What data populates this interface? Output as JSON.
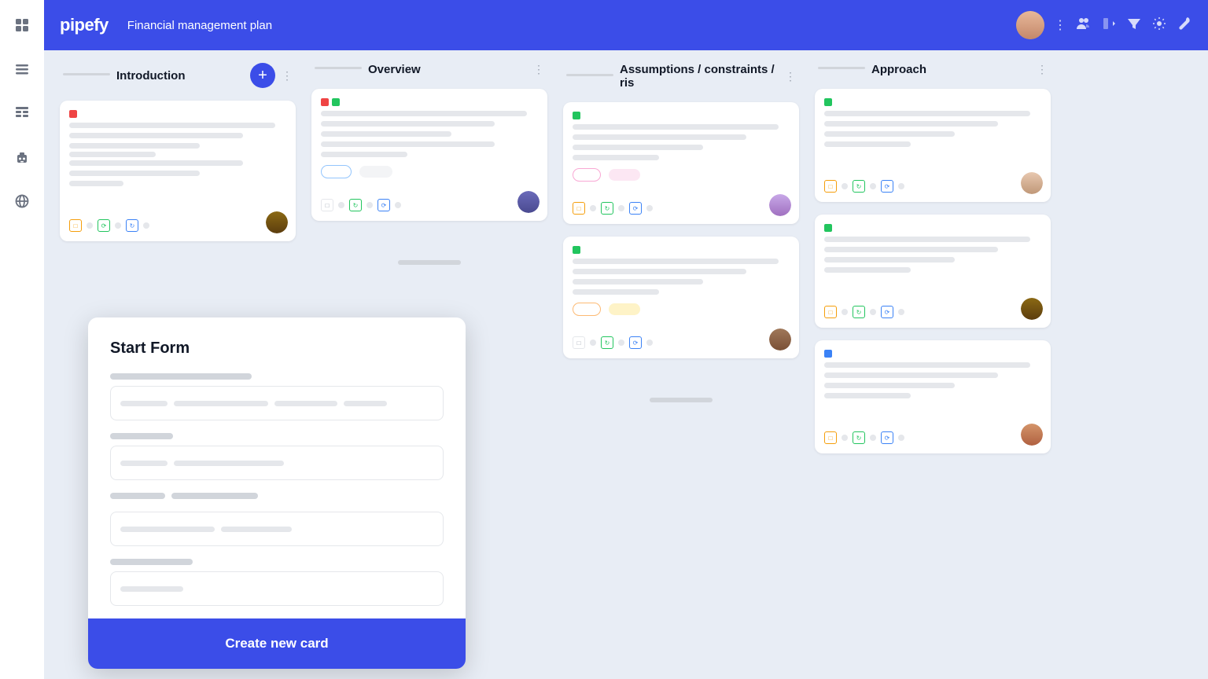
{
  "app": {
    "name": "pipefy",
    "title": "Financial management plan"
  },
  "sidebar": {
    "icons": [
      "grid",
      "list",
      "table",
      "robot",
      "globe"
    ]
  },
  "header": {
    "actions": [
      "people",
      "enter",
      "filter",
      "settings",
      "tool",
      "more"
    ]
  },
  "columns": [
    {
      "id": "introduction",
      "title": "Introduction",
      "has_add": true
    },
    {
      "id": "overview",
      "title": "Overview",
      "has_add": false
    },
    {
      "id": "assumptions",
      "title": "Assumptions / constraints / ris",
      "has_add": false
    },
    {
      "id": "approach",
      "title": "Approach",
      "has_add": false
    }
  ],
  "start_form": {
    "title": "Start Form",
    "field1_label": "wide",
    "field2_label": "narrow",
    "field3_label": "medium",
    "field4_label": "short",
    "create_button": "Create new card"
  }
}
